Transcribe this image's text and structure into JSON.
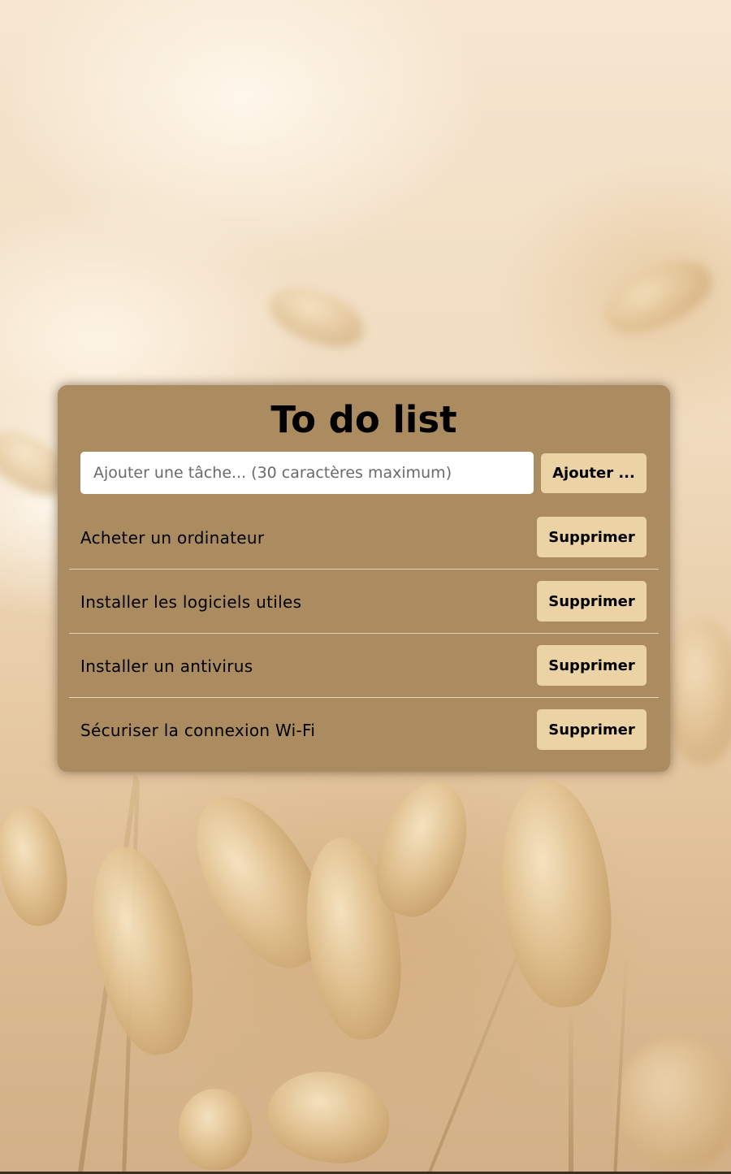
{
  "app": {
    "title": "To do list"
  },
  "form": {
    "input_value": "",
    "input_placeholder": "Ajouter une tâche... (30 caractères maximum)",
    "add_label": "Ajouter ..."
  },
  "tasks": [
    {
      "text": "Acheter un ordinateur",
      "delete_label": "Supprimer"
    },
    {
      "text": "Installer les logiciels utiles",
      "delete_label": "Supprimer"
    },
    {
      "text": "Installer un antivirus",
      "delete_label": "Supprimer"
    },
    {
      "text": "Sécuriser la connexion Wi-Fi",
      "delete_label": "Supprimer"
    }
  ],
  "colors": {
    "card_background": "#ab8c61",
    "button_background": "#ecd3a5",
    "separator": "#e2d3bd",
    "input_background": "#ffffff"
  }
}
